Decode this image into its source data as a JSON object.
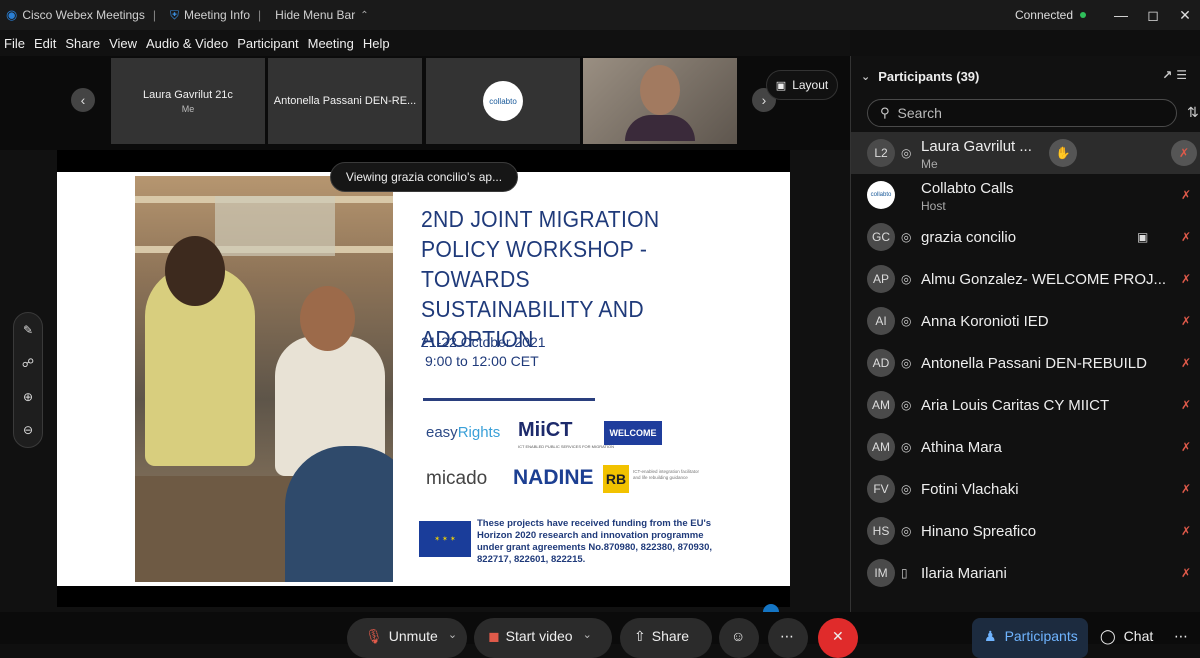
{
  "titlebar": {
    "app_name": "Cisco Webex Meetings",
    "meeting_info": "Meeting Info",
    "hide_menu": "Hide Menu Bar",
    "status": "Connected"
  },
  "menu": [
    "File",
    "Edit",
    "Share",
    "View",
    "Audio & Video",
    "Participant",
    "Meeting",
    "Help"
  ],
  "video_strip": {
    "thumbs": [
      {
        "name": "Laura Gavrilut 21c",
        "sub": "Me"
      },
      {
        "name": "Antonella Passani DEN-RE...",
        "sub": ""
      },
      {
        "name": "collabto",
        "sub": ""
      },
      {
        "name": "",
        "sub": ""
      }
    ],
    "layout_label": "Layout"
  },
  "toast": "Viewing grazia concilio's ap...",
  "slide": {
    "title": "2ND JOINT MIGRATION POLICY WORKSHOP - TOWARDS SUSTAINABILITY AND ADOPTION",
    "date": "21-22 October 2021",
    "time": "9:00 to 12:00 CET",
    "logos": {
      "easy": "easy",
      "rights": "Rights",
      "miict": "MiiCT",
      "miict_sub": "ICT ENABLED PUBLIC SERVICES FOR MIGRATION",
      "welcome": "WELCOME",
      "micado": "micado",
      "nadine": "NADINE",
      "rb": "RB",
      "rb_text": "ICT-enabled integration facilitator and life rebuilding guidance"
    },
    "funding": "These projects have received funding from the EU's Horizon 2020 research and innovation programme under grant agreements No.870980, 822380, 870930, 822717, 822601, 822215."
  },
  "controls": {
    "unmute": "Unmute",
    "start_video": "Start video",
    "share": "Share",
    "participants_tab": "Participants",
    "chat_tab": "Chat"
  },
  "panel": {
    "title": "Participants (39)",
    "search_placeholder": "Search",
    "participants": [
      {
        "initials": "L2",
        "name": "Laura Gavrilut ...",
        "sub": "Me",
        "raise": true,
        "device": "headset"
      },
      {
        "initials": "collabto",
        "name": "Collabto Calls",
        "sub": "Host",
        "device": ""
      },
      {
        "initials": "GC",
        "name": "grazia concilio",
        "sub": "",
        "device": "headset",
        "camera": true
      },
      {
        "initials": "AP",
        "name": "Almu Gonzalez- WELCOME PROJ...",
        "sub": "",
        "device": "headset"
      },
      {
        "initials": "AI",
        "name": "Anna Koronioti IED",
        "sub": "",
        "device": "headset"
      },
      {
        "initials": "AD",
        "name": "Antonella Passani DEN-REBUILD",
        "sub": "",
        "device": "headset"
      },
      {
        "initials": "AM",
        "name": "Aria Louis Caritas CY MIICT",
        "sub": "",
        "device": "headset"
      },
      {
        "initials": "AM",
        "name": "Athina Mara",
        "sub": "",
        "device": "headset"
      },
      {
        "initials": "FV",
        "name": "Fotini Vlachaki",
        "sub": "",
        "device": "headset"
      },
      {
        "initials": "HS",
        "name": "Hinano Spreafico",
        "sub": "",
        "device": "headset"
      },
      {
        "initials": "IM",
        "name": "Ilaria Mariani",
        "sub": "",
        "device": "phone"
      }
    ]
  },
  "colors": {
    "accent": "#1f3a7a",
    "muted_mic": "#e05a4a",
    "connected": "#2fbf5b",
    "end_call": "#e02b2b"
  }
}
